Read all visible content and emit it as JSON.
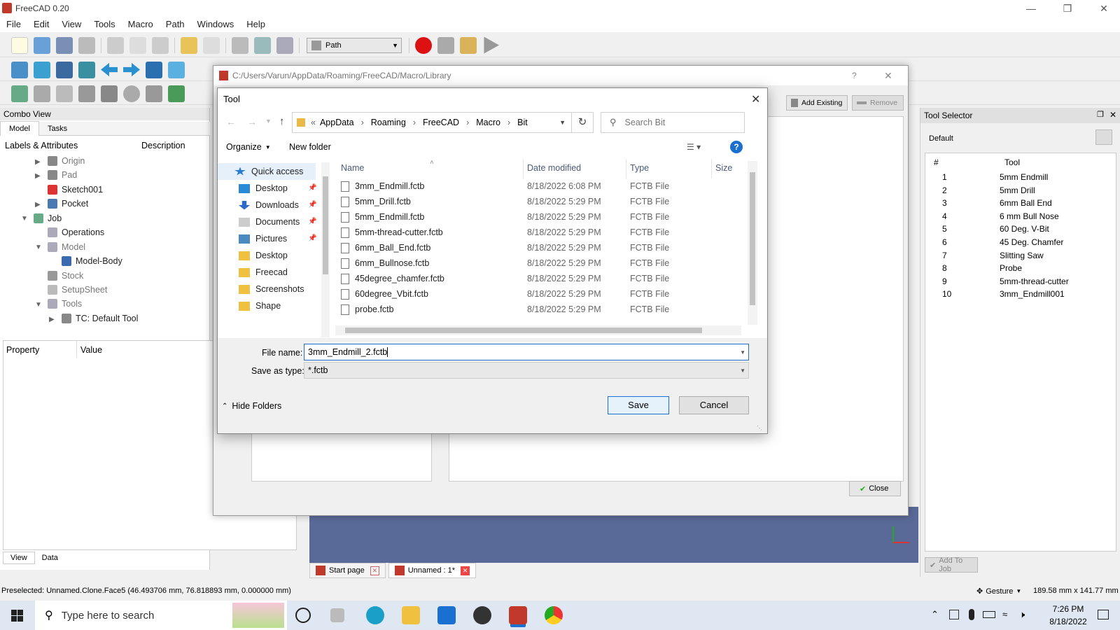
{
  "app": {
    "title": "FreeCAD 0.20"
  },
  "menu": [
    "File",
    "Edit",
    "View",
    "Tools",
    "Macro",
    "Path",
    "Windows",
    "Help"
  ],
  "workbench": "Path",
  "combo": {
    "title": "Combo View",
    "tabs": [
      "Model",
      "Tasks"
    ],
    "col1": "Labels & Attributes",
    "col2": "Description",
    "tree": [
      "Origin",
      "Pad",
      "Sketch001",
      "Pocket",
      "Job",
      "Operations",
      "Model",
      "Model-Body",
      "Stock",
      "SetupSheet",
      "Tools",
      "TC: Default Tool"
    ],
    "prop": "Property",
    "val": "Value",
    "bottom_tabs": [
      "View",
      "Data"
    ]
  },
  "bgdialog": {
    "title": "C:/Users/Varun/AppData/Roaming/FreeCAD/Macro/Library",
    "help": "?",
    "add_existing": "Add Existing",
    "remove": "Remove",
    "close": "Close"
  },
  "toolsel": {
    "title": "Tool Selector",
    "library": "Default",
    "col_num": "#",
    "col_tool": "Tool",
    "tools": [
      [
        "1",
        "5mm Endmill"
      ],
      [
        "2",
        "5mm Drill"
      ],
      [
        "3",
        "6mm Ball End"
      ],
      [
        "4",
        "6 mm Bull Nose"
      ],
      [
        "5",
        "60 Deg. V-Bit"
      ],
      [
        "6",
        "45 Deg. Chamfer"
      ],
      [
        "7",
        "Slitting Saw"
      ],
      [
        "8",
        "Probe"
      ],
      [
        "9",
        "5mm-thread-cutter"
      ],
      [
        "10",
        "3mm_Endmill001"
      ]
    ],
    "add_to_job": "Add To Job"
  },
  "filedlg": {
    "title": "Tool",
    "breadcrumb": [
      "AppData",
      "Roaming",
      "FreeCAD",
      "Macro",
      "Bit"
    ],
    "search_placeholder": "Search Bit",
    "organize": "Organize",
    "new_folder": "New folder",
    "nav": [
      "Quick access",
      "Desktop",
      "Downloads",
      "Documents",
      "Pictures",
      "Desktop",
      "Freecad",
      "Screenshots",
      "Shape"
    ],
    "cols": [
      "Name",
      "Date modified",
      "Type",
      "Size"
    ],
    "files": [
      [
        "3mm_Endmill.fctb",
        "8/18/2022 6:08 PM",
        "FCTB File"
      ],
      [
        "5mm_Drill.fctb",
        "8/18/2022 5:29 PM",
        "FCTB File"
      ],
      [
        "5mm_Endmill.fctb",
        "8/18/2022 5:29 PM",
        "FCTB File"
      ],
      [
        "5mm-thread-cutter.fctb",
        "8/18/2022 5:29 PM",
        "FCTB File"
      ],
      [
        "6mm_Ball_End.fctb",
        "8/18/2022 5:29 PM",
        "FCTB File"
      ],
      [
        "6mm_Bullnose.fctb",
        "8/18/2022 5:29 PM",
        "FCTB File"
      ],
      [
        "45degree_chamfer.fctb",
        "8/18/2022 5:29 PM",
        "FCTB File"
      ],
      [
        "60degree_Vbit.fctb",
        "8/18/2022 5:29 PM",
        "FCTB File"
      ],
      [
        "probe.fctb",
        "8/18/2022 5:29 PM",
        "FCTB File"
      ]
    ],
    "filename_label": "File name:",
    "filename": "3mm_Endmill_2.fctb",
    "savetype_label": "Save as type:",
    "savetype": "*.fctb",
    "hide_folders": "Hide Folders",
    "save": "Save",
    "cancel": "Cancel"
  },
  "doc_tabs": [
    "Start page",
    "Unnamed : 1*"
  ],
  "status": {
    "text": "Preselected: Unnamed.Clone.Face5 (46.493706 mm, 76.818893 mm, 0.000000 mm)",
    "nav": "Gesture",
    "dims": "189.58 mm x 141.77 mm"
  },
  "taskbar": {
    "search": "Type here to search",
    "time": "7:26 PM",
    "date": "8/18/2022"
  }
}
